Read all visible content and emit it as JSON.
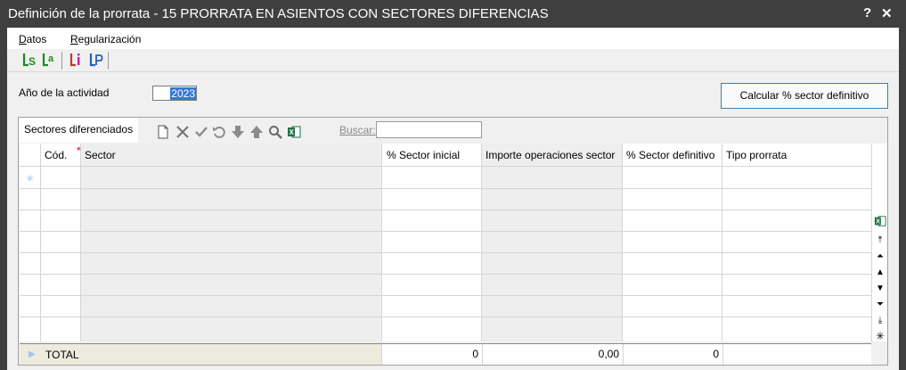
{
  "window": {
    "title": "Definición de la prorrata - 15 PRORRATA EN ASIENTOS CON SECTORES DIFERENCIAS",
    "help": "?",
    "close": "✕"
  },
  "menu": {
    "datos_u": "D",
    "datos_rest": "atos",
    "reg_u": "R",
    "reg_rest": "egularización"
  },
  "form": {
    "anio_label": "Año de la actividad",
    "anio_value": "2023",
    "calc_button": "Calcular % sector definitivo"
  },
  "panel": {
    "tab": "Sectores diferenciados",
    "buscar_label": "Buscar:",
    "buscar_value": "",
    "columns": [
      "Cód.",
      "Sector",
      "% Sector inicial",
      "Importe operaciones sector",
      "% Sector definitivo",
      "Tipo prorrata"
    ],
    "required_mark": "*",
    "total_label": "TOTAL",
    "totals": {
      "sector_inicial": "0",
      "importe": "0,00",
      "sector_definitivo": "0"
    }
  },
  "colors": {
    "titlebar": "#3f3f3f",
    "selection": "#3578d6",
    "total_bg": "#ecebde"
  }
}
